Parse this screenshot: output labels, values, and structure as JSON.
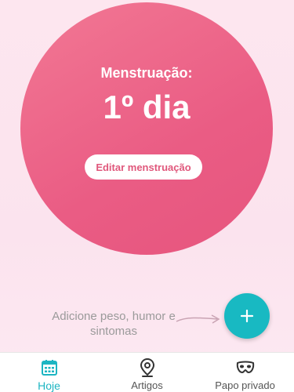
{
  "hero": {
    "title": "Menstruação:",
    "day": "1º dia",
    "edit_button": "Editar menstruação"
  },
  "hint": {
    "text": "Adicione peso, humor e sintomas"
  },
  "fab": {
    "icon": "plus-icon"
  },
  "nav": {
    "items": [
      {
        "label": "Hoje",
        "icon": "calendar-icon",
        "active": true
      },
      {
        "label": "Artigos",
        "icon": "location-pin-icon",
        "active": false
      },
      {
        "label": "Papo privado",
        "icon": "mask-icon",
        "active": false
      }
    ]
  },
  "colors": {
    "accent": "#1cb5c2",
    "circle": "#ea5c84",
    "background": "#fde6ef"
  }
}
